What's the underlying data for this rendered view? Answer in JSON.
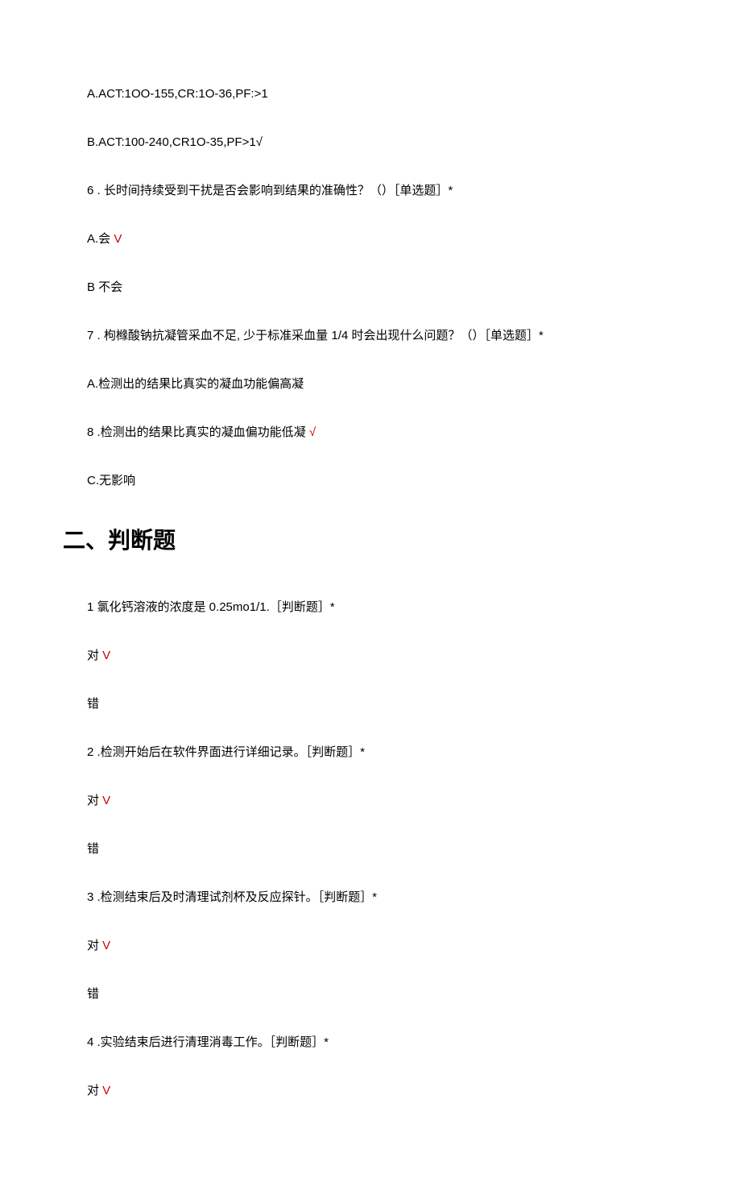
{
  "q5": {
    "optionA": "A.ACT:1OO-155,CR:1O-36,PF:>1",
    "optionB": "B.ACT:100-240,CR1O-35,PF>1√"
  },
  "q6": {
    "question": "6  . 长时间持续受到干扰是否会影响到结果的准确性？（）［单选题］*",
    "optionA_prefix": "A.会 ",
    "optionA_mark": "V",
    "optionB": "B 不会"
  },
  "q7": {
    "question": "7  . 枸橼酸钠抗凝管采血不足, 少于标准采血量 1/4 时会出现什么问题？（）［单选题］*",
    "optionA": "A.检测出的结果比真实的凝血功能偏高凝"
  },
  "q8": {
    "text": "8  .检测出的结果比真实的凝血偏功能低凝 ",
    "mark": "√",
    "optionC": "C.无影响"
  },
  "section2": {
    "title": "二、判断题"
  },
  "s2q1": {
    "question": "1 氯化钙溶液的浓度是 0.25mo1/1.［判断题］*",
    "correct_prefix": "对 ",
    "correct_mark": "V",
    "wrong": "错"
  },
  "s2q2": {
    "question": "2  .检测开始后在软件界面进行详细记录。［判断题］*",
    "correct_prefix": "对 ",
    "correct_mark": "V",
    "wrong": "错"
  },
  "s2q3": {
    "question": "3  .检测结束后及时清理试剂杯及反应探针。［判断题］*",
    "correct_prefix": "对 ",
    "correct_mark": "V",
    "wrong": "错"
  },
  "s2q4": {
    "question": "4  .实验结束后进行清理消毒工作。［判断题］*",
    "correct_prefix": "对 ",
    "correct_mark": "V"
  }
}
